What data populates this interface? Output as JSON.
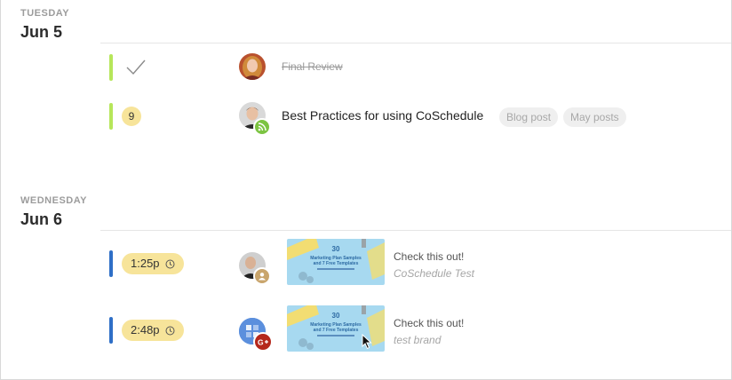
{
  "days": [
    {
      "weekday": "TUESDAY",
      "date": "Jun 5",
      "items": [
        {
          "status": "completed",
          "title": "Final Review"
        },
        {
          "count": "9",
          "title": "Best Practices for using CoSchedule",
          "tags": [
            "Blog post",
            "May posts"
          ]
        }
      ]
    },
    {
      "weekday": "WEDNESDAY",
      "date": "Jun 6",
      "items": [
        {
          "time": "1:25p",
          "title": "Check this out!",
          "subtitle": "CoSchedule Test",
          "thumbnail_text": "30 Marketing Plan Samples and 7 Free Templates"
        },
        {
          "time": "2:48p",
          "title": "Check this out!",
          "subtitle": "test brand",
          "thumbnail_text": "30 Marketing Plan Samples and 7 Free Templates"
        }
      ]
    }
  ],
  "colors": {
    "done_bar": "#b6e65a",
    "social_bar": "#2f6fc7",
    "time_pill": "#f7e49a"
  },
  "icons": {
    "completed": "checkmark-icon",
    "blog": "rss-feed-icon",
    "profile": "user-icon",
    "google_plus": "google-plus-icon",
    "time": "clock-icon"
  }
}
